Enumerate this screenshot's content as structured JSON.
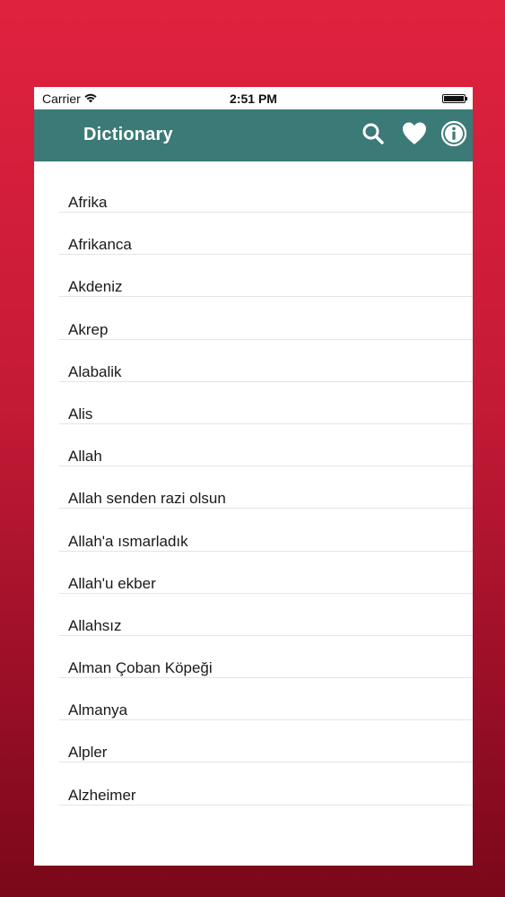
{
  "status_bar": {
    "carrier": "Carrier",
    "time": "2:51 PM"
  },
  "navbar": {
    "title": "Dictionary",
    "background_color": "#3b7a76",
    "icons": [
      "search-icon",
      "heart-icon",
      "info-icon"
    ]
  },
  "background_color": "#d01f3a",
  "words": [
    {
      "label": "Afrika"
    },
    {
      "label": "Afrikanca"
    },
    {
      "label": "Akdeniz"
    },
    {
      "label": "Akrep"
    },
    {
      "label": "Alabalik"
    },
    {
      "label": "Alis"
    },
    {
      "label": "Allah"
    },
    {
      "label": "Allah senden razi olsun"
    },
    {
      "label": "Allah'a ısmarladık"
    },
    {
      "label": "Allah'u ekber"
    },
    {
      "label": "Allahsız"
    },
    {
      "label": "Alman Çoban Köpeği"
    },
    {
      "label": "Almanya"
    },
    {
      "label": "Alpler"
    },
    {
      "label": "Alzheimer"
    }
  ]
}
